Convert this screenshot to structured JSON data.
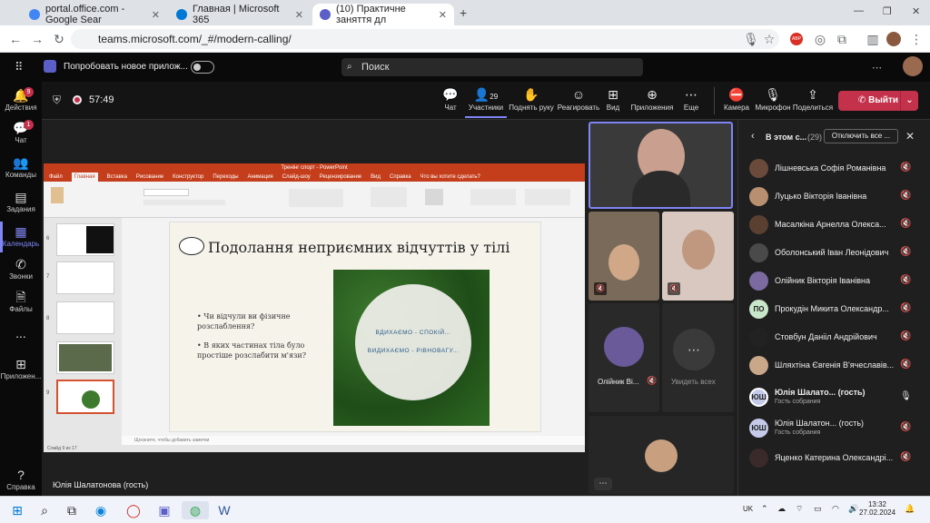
{
  "browser": {
    "tabs": [
      {
        "title": "portal.office.com - Google Sear",
        "color": "#4285f4"
      },
      {
        "title": "Главная | Microsoft 365",
        "color": "#0078d4"
      },
      {
        "title": "(10) Практичне заняття дл",
        "color": "#5b5fc7"
      }
    ],
    "url": "teams.microsoft.com/_#/modern-calling/"
  },
  "teams": {
    "try_new": "Попробовать новое прилож...",
    "search_placeholder": "Поиск",
    "rail": [
      {
        "label": "Действия",
        "icon": "bell-icon",
        "badge": "9"
      },
      {
        "label": "Чат",
        "icon": "chat-icon",
        "badge": "1"
      },
      {
        "label": "Команды",
        "icon": "teams-icon",
        "badge": ""
      },
      {
        "label": "Задания",
        "icon": "assignments-icon",
        "badge": ""
      },
      {
        "label": "Календарь",
        "icon": "calendar-icon",
        "badge": ""
      },
      {
        "label": "Звонки",
        "icon": "phone-icon",
        "badge": ""
      },
      {
        "label": "Файлы",
        "icon": "files-icon",
        "badge": ""
      },
      {
        "label": "...",
        "icon": "more-icon",
        "badge": ""
      },
      {
        "label": "Приложен...",
        "icon": "apps-icon",
        "badge": ""
      }
    ],
    "help": "Справка"
  },
  "meeting": {
    "timer": "57:49",
    "controls": [
      {
        "label": "Чат",
        "icon": "chat-icon"
      },
      {
        "label": "Участники",
        "icon": "people-icon",
        "count": "29"
      },
      {
        "label": "Поднять руку",
        "icon": "hand-icon"
      },
      {
        "label": "Реагировать",
        "icon": "smile-icon"
      },
      {
        "label": "Вид",
        "icon": "grid-icon"
      },
      {
        "label": "Приложения",
        "icon": "plus-icon"
      },
      {
        "label": "Еще",
        "icon": "more-icon"
      },
      {
        "label": "Камера",
        "icon": "camera-icon"
      },
      {
        "label": "Микрофон",
        "icon": "mic-icon"
      },
      {
        "label": "Поделиться",
        "icon": "share-icon"
      }
    ],
    "leave": "Выйти",
    "presenter": "Юлія Шалатонова (гость)"
  },
  "ppt": {
    "doc_title": "Тренінг спорт - PowerPoint",
    "menu": [
      "Файл",
      "Главная",
      "Вставка",
      "Рисование",
      "Конструктор",
      "Переходы",
      "Анимация",
      "Слайд-шоу",
      "Рецензирование",
      "Вид",
      "Справка",
      "Что вы хотите сделать?"
    ],
    "slide_title": "Подолання неприємних відчуттів у тілі",
    "bullets": [
      "Чи відчули ви фізичне розслаблення?",
      "В яких частинах тіла було простіше розслабити м'язи?"
    ],
    "image_text1": "ВДИХАЄМО - СПОКІЙ...",
    "image_text2": "ВИДИХАЄМО - РІВНОВАГУ...",
    "thumb_nums": [
      "6",
      "7",
      "8",
      "9"
    ],
    "notes": "Щоскните, чтобы добавить заметки",
    "status": "Слайд 9 из 17"
  },
  "tiles": {
    "olijnyk_label": "Олійник Ві...",
    "see_all": "Увидеть всех"
  },
  "panel": {
    "title": "В этом с...",
    "count": "(29)",
    "mute_all": "Отключить все ...",
    "people": [
      {
        "name": "Лішневська Софія Романівна",
        "sub": "",
        "initials": "",
        "mic": "off"
      },
      {
        "name": "Луцько Вікторія Іванівна",
        "sub": "",
        "initials": "",
        "mic": "off"
      },
      {
        "name": "Масалкіна Арнелла Олекса...",
        "sub": "",
        "initials": "",
        "mic": "off"
      },
      {
        "name": "Оболонський Іван Леонідович",
        "sub": "",
        "initials": "",
        "mic": "off"
      },
      {
        "name": "Олійник Вікторія Іванівна",
        "sub": "",
        "initials": "",
        "mic": "off"
      },
      {
        "name": "Прокудін Микита Олександр...",
        "sub": "",
        "initials": "ПО",
        "mic": "off"
      },
      {
        "name": "Стовбун Данііл Андрійович",
        "sub": "",
        "initials": "",
        "mic": "off"
      },
      {
        "name": "Шляхтіна Євгенія В'ячеславів...",
        "sub": "",
        "initials": "",
        "mic": "off"
      },
      {
        "name": "Юлія Шалато...  (гость)",
        "sub": "Гость собрания",
        "initials": "ЮШ",
        "mic": "on"
      },
      {
        "name": "Юлія Шалатон...  (гость)",
        "sub": "Гость собрания",
        "initials": "ЮШ",
        "mic": "off"
      },
      {
        "name": "Яценко Катерина Олександрі...",
        "sub": "",
        "initials": "",
        "mic": "off"
      }
    ]
  },
  "taskbar": {
    "lang": "UK",
    "time": "13:32",
    "date": "27.02.2024"
  }
}
